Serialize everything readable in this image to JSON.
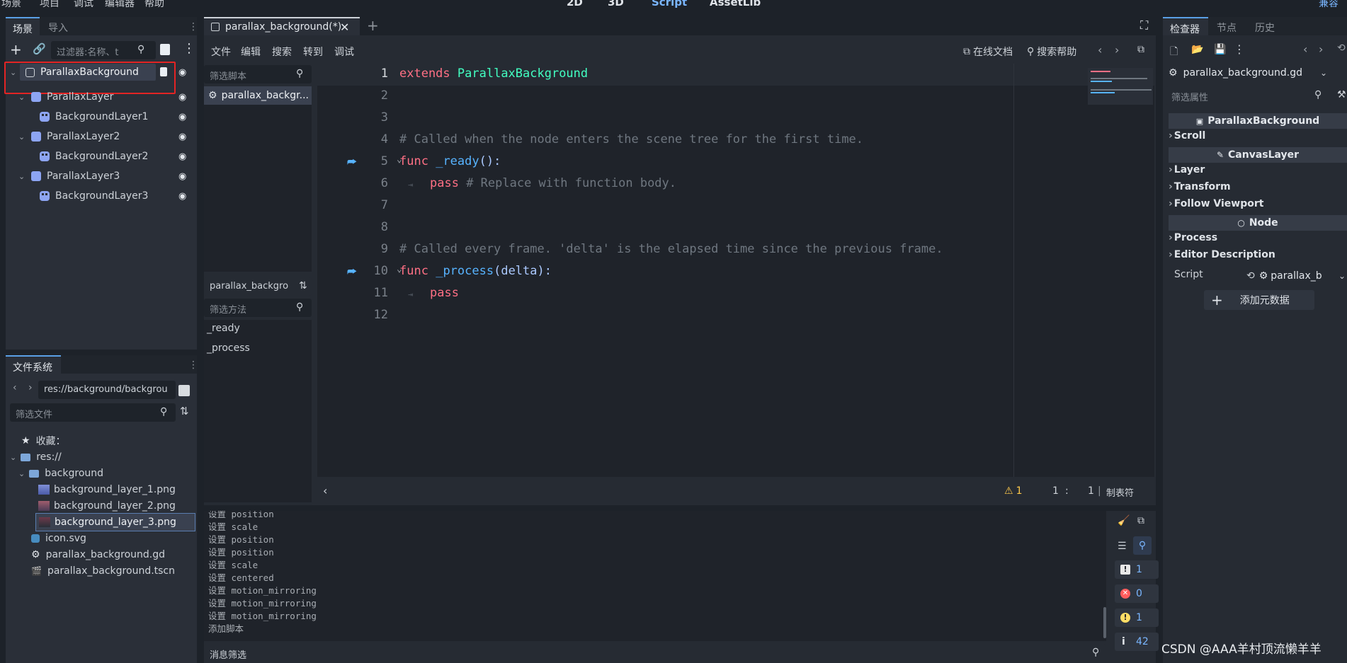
{
  "topbar": {
    "menus": [
      "场景",
      "项目",
      "调试",
      "编辑器",
      "帮助"
    ],
    "modes": [
      "2D",
      "3D",
      "Script",
      "AssetLib"
    ],
    "right_label": "兼容"
  },
  "scene_dock": {
    "tabs": [
      "场景",
      "导入"
    ],
    "filter_placeholder": "过滤器:名称、t",
    "tree": [
      {
        "label": "ParallaxBackground"
      },
      {
        "label": "ParallaxLayer"
      },
      {
        "label": "BackgroundLayer1"
      },
      {
        "label": "ParallaxLayer2"
      },
      {
        "label": "BackgroundLayer2"
      },
      {
        "label": "ParallaxLayer3"
      },
      {
        "label": "BackgroundLayer3"
      }
    ]
  },
  "fs_dock": {
    "title": "文件系统",
    "path": "res://background/backgrou",
    "filter_placeholder": "筛选文件",
    "items": [
      "收藏：",
      "res://",
      "background",
      "background_layer_1.png",
      "background_layer_2.png",
      "background_layer_3.png",
      "icon.svg",
      "parallax_background.gd",
      "parallax_background.tscn"
    ]
  },
  "editor": {
    "doc_tab": "parallax_background(*)",
    "menus": [
      "文件",
      "编辑",
      "搜索",
      "转到",
      "调试"
    ],
    "online_docs": "在线文档",
    "search_help": "搜索帮助",
    "script_filter_placeholder": "筛选脚本",
    "script_item": "parallax_backgr...",
    "current_script": "parallax_backgro",
    "method_filter_placeholder": "筛选方法",
    "methods": [
      "_ready",
      "_process"
    ],
    "line_numbers": [
      "1",
      "2",
      "3",
      "4",
      "5",
      "6",
      "7",
      "8",
      "9",
      "10",
      "11",
      "12"
    ],
    "code": {
      "l1_kw": "extends",
      "l1_ty": "ParallaxBackground",
      "l4": "# Called when the node enters the scene tree for the first time.",
      "l5_kw": "func",
      "l5_fn": "_ready",
      "l5_rest": "():",
      "l6_kw": "pass",
      "l6_cm": "# Replace with function body.",
      "l9": "# Called every frame. 'delta' is the elapsed time since the previous frame.",
      "l10_kw": "func",
      "l10_fn": "_process",
      "l10_rest": "(delta):",
      "l11_kw": "pass"
    },
    "status": {
      "warnings": "1",
      "line": "1",
      "sep": ":",
      "col": "1",
      "indent": "制表符"
    }
  },
  "output": {
    "lines": [
      "设置 position",
      "设置 scale",
      "设置 position",
      "设置 position",
      "设置 scale",
      "设置 centered",
      "设置 motion_mirroring",
      "设置 motion_mirroring",
      "设置 motion_mirroring",
      "添加脚本"
    ],
    "filter_placeholder": "消息筛选",
    "counts": {
      "errors": "1",
      "error_x": "0",
      "warnings": "1",
      "info": "42"
    }
  },
  "inspector": {
    "tabs": [
      "检查器",
      "节点",
      "历史"
    ],
    "resource": "parallax_background.gd",
    "filter_placeholder": "筛选属性",
    "cat1": "ParallaxBackground",
    "s_scroll": "Scroll",
    "cat2": "CanvasLayer",
    "s_layer": "Layer",
    "s_transform": "Transform",
    "s_follow": "Follow Viewport",
    "cat3": "Node",
    "s_process": "Process",
    "s_editor_desc": "Editor Description",
    "script_label": "Script",
    "script_value": "parallax_b",
    "add_meta": "添加元数据"
  },
  "watermark": "CSDN @AAA羊村顶流懒羊羊"
}
